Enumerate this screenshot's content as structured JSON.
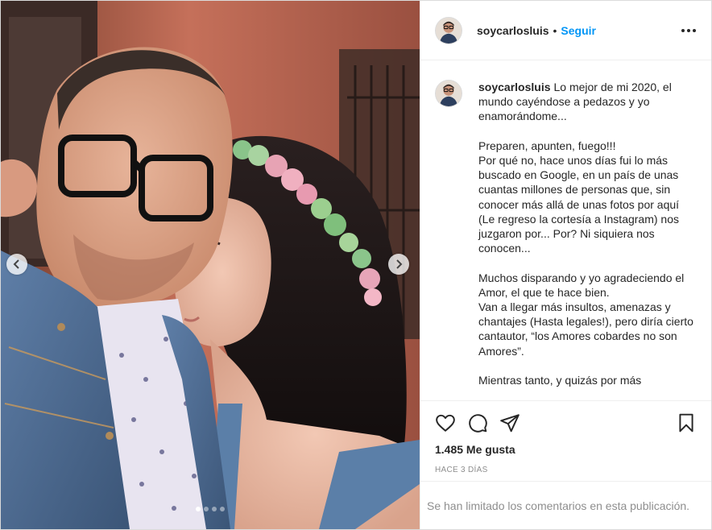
{
  "post": {
    "username": "soycarlosluis",
    "bullet": "•",
    "follow_label": "Seguir",
    "more_icon": "more-horizontal-icon",
    "caption": {
      "username": "soycarlosluis",
      "text": "Lo mejor de mi 2020, el mundo cayéndose a pedazos y yo enamorándome...\n\nPreparen, apunten, fuego!!!\nPor qué no, hace unos días fui lo más buscado en Google, en un país de unas cuantas millones de personas que, sin conocer más allá de unas fotos por aquí (Le regreso la cortesía a Instagram) nos juzgaron por... Por? Ni siquiera nos conocen...\n\nMuchos disparando y yo agradeciendo el Amor, el que te hace bien.\nVan a llegar más insultos, amenazas y chantajes (Hasta legales!), pero diría cierto cantautor, “los Amores cobardes no son Amores”.\n\nMientras tanto, y quizás por más"
    },
    "likes": "1.485 Me gusta",
    "time": "HACE 3 DÍAS",
    "comments_limited": "Se han limitado los comentarios en esta publicación.",
    "carousel": {
      "slides": 4,
      "active_index": 0
    },
    "accent_color": "#0095f6",
    "muted_color": "#8e8e8e"
  }
}
